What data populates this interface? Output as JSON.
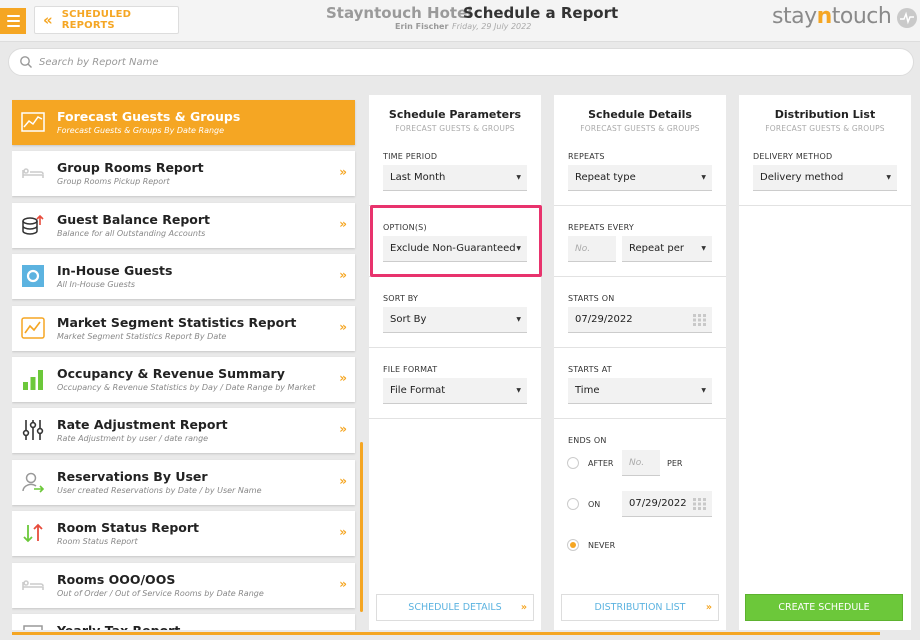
{
  "header": {
    "back_label": "SCHEDULED REPORTS",
    "hotel_name": "Stayntouch Hotel",
    "page_title": "Schedule a Report",
    "user_name": "Erin Fischer",
    "date": "Friday, 29 July 2022",
    "brand_pre": "stay",
    "brand_accent": "n",
    "brand_post": "touch"
  },
  "search": {
    "placeholder": "Search by Report Name"
  },
  "reports": [
    {
      "title": "Forecast Guests & Groups",
      "subtitle": "Forecast Guests & Groups By Date Range",
      "icon": "forecast-chart-icon",
      "active": true
    },
    {
      "title": "Group Rooms Report",
      "subtitle": "Group Rooms Pickup Report",
      "icon": "bed-icon"
    },
    {
      "title": "Guest Balance Report",
      "subtitle": "Balance for all Outstanding Accounts",
      "icon": "coins-icon"
    },
    {
      "title": "In-House Guests",
      "subtitle": "All In-House Guests",
      "icon": "in-house-icon"
    },
    {
      "title": "Market Segment Statistics Report",
      "subtitle": "Market Segment Statistics Report By Date",
      "icon": "line-chart-icon"
    },
    {
      "title": "Occupancy & Revenue Summary",
      "subtitle": "Occupancy & Revenue Statistics by Day / Date Range by Market",
      "icon": "bar-chart-icon"
    },
    {
      "title": "Rate Adjustment Report",
      "subtitle": "Rate Adjustment by user / date range",
      "icon": "sliders-icon"
    },
    {
      "title": "Reservations By User",
      "subtitle": "User created Reservations by Date / by User Name",
      "icon": "user-arrow-icon"
    },
    {
      "title": "Room Status Report",
      "subtitle": "Room Status Report",
      "icon": "up-down-arrows-icon"
    },
    {
      "title": "Rooms OOO/OOS",
      "subtitle": "Out of Order / Out of Service Rooms by Date Range",
      "icon": "bed-icon"
    },
    {
      "title": "Yearly Tax Report",
      "subtitle": "",
      "icon": "tax-icon"
    }
  ],
  "schedule_parameters": {
    "title": "Schedule Parameters",
    "subtitle": "FORECAST GUESTS & GROUPS",
    "time_period_label": "TIME PERIOD",
    "time_period_value": "Last Month",
    "options_label": "OPTION(S)",
    "options_value": "Exclude Non-Guaranteed",
    "sort_by_label": "SORT BY",
    "sort_by_value": "Sort By",
    "file_format_label": "FILE FORMAT",
    "file_format_value": "File Format",
    "footer_button": "SCHEDULE DETAILS"
  },
  "schedule_details": {
    "title": "Schedule Details",
    "subtitle": "FORECAST GUESTS & GROUPS",
    "repeats_label": "REPEATS",
    "repeats_value": "Repeat type",
    "repeats_every_label": "REPEATS EVERY",
    "repeats_every_placeholder": "No.",
    "repeat_per_value": "Repeat per",
    "starts_on_label": "STARTS ON",
    "starts_on_value": "07/29/2022",
    "starts_at_label": "STARTS AT",
    "starts_at_value": "Time",
    "ends_on_label": "ENDS ON",
    "after_label": "AFTER",
    "after_placeholder": "No.",
    "per_label": "PER",
    "on_label": "ON",
    "on_date_value": "07/29/2022",
    "never_label": "NEVER",
    "footer_button": "DISTRIBUTION LIST"
  },
  "distribution_list": {
    "title": "Distribution List",
    "subtitle": "FORECAST GUESTS & GROUPS",
    "delivery_method_label": "DELIVERY METHOD",
    "delivery_method_value": "Delivery method",
    "create_button": "CREATE SCHEDULE"
  },
  "colors": {
    "accent": "#f5a623",
    "highlight": "#e8336d",
    "create": "#6cc83a",
    "link": "#5cb3e0"
  }
}
